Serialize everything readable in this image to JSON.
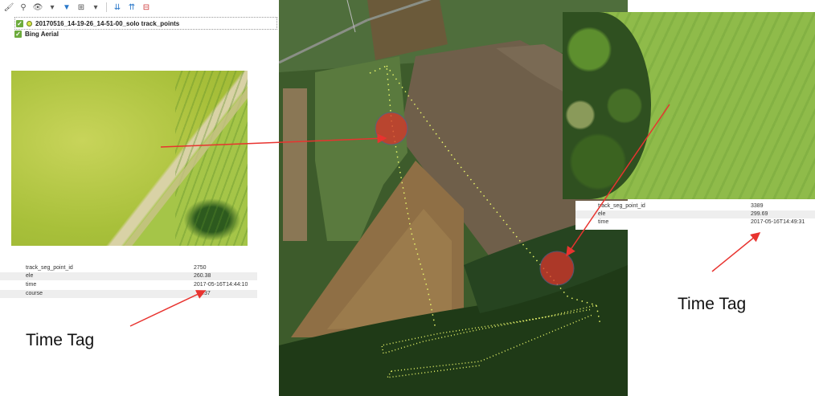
{
  "toolbar": {
    "icons": [
      "style-icon",
      "identify-icon",
      "visibility-icon",
      "filter-icon",
      "group-icon",
      "dropdown-icon",
      "expand-icon",
      "collapse-icon",
      "remove-icon"
    ]
  },
  "layers": [
    {
      "name": "20170516_14-19-26_14-51-00_solo track_points",
      "checked": true
    },
    {
      "name": "Bing Aerial",
      "checked": true
    }
  ],
  "left_attributes": [
    {
      "key": "track_seg_point_id",
      "value": "2750"
    },
    {
      "key": "ele",
      "value": "260.38"
    },
    {
      "key": "time",
      "value": "2017-05-16T14:44:10"
    },
    {
      "key": "course",
      "value": ".37"
    }
  ],
  "right_attributes": [
    {
      "key": "track_seg_point_id",
      "value": "3389"
    },
    {
      "key": "ele",
      "value": "299.69"
    },
    {
      "key": "time",
      "value": "2017-05-16T14:49:31"
    }
  ],
  "annotations": {
    "time_tag_left": "Time Tag",
    "time_tag_right": "Time Tag"
  },
  "colors": {
    "arrow": "#e8332f",
    "highlight": "#d9342b",
    "track": "#e8f56a"
  }
}
